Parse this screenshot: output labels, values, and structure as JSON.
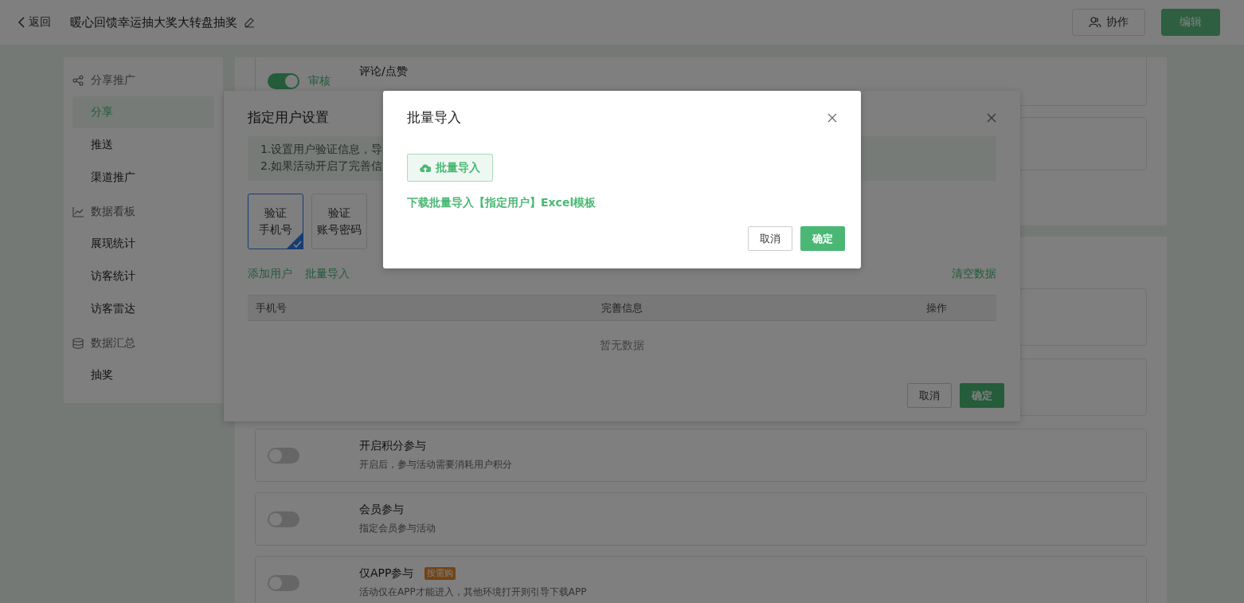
{
  "header": {
    "back": "返回",
    "title": "暖心回馈幸运抽大奖大转盘抽奖",
    "buttons": [
      {
        "label": "协作",
        "kind": "outline"
      },
      {
        "label": "编辑",
        "kind": "primary"
      }
    ]
  },
  "sidebar": {
    "groups": [
      {
        "label": "分享推广",
        "items": [
          {
            "label": "分享",
            "selected": true
          },
          {
            "label": "推送",
            "selected": false
          },
          {
            "label": "渠道推广",
            "selected": false
          }
        ]
      },
      {
        "label": "数据看板",
        "items": [
          {
            "label": "展现统计",
            "selected": false
          },
          {
            "label": "访客统计",
            "selected": false
          },
          {
            "label": "访客雷达",
            "selected": false
          }
        ]
      },
      {
        "label": "数据汇总",
        "items": [
          {
            "label": "抽奖",
            "selected": false
          }
        ]
      }
    ]
  },
  "main": {
    "sections": [
      {
        "cards": [
          {
            "kind": "setting",
            "on": true,
            "switch_label": "审核",
            "title": "评论/点赞"
          },
          {
            "kind": "blank"
          }
        ]
      },
      {
        "cards": [
          {
            "kind": "blank"
          },
          {
            "kind": "blank"
          },
          {
            "kind": "setting",
            "on": false,
            "title": "开启积分参与",
            "description": "开启后，参与活动需要消耗用户积分"
          },
          {
            "kind": "setting",
            "on": false,
            "title": "会员参与",
            "description": "指定会员参与活动"
          },
          {
            "kind": "setting",
            "on": false,
            "title": "仅APP参与",
            "badge": "按需购",
            "description": "活动仅在APP才能进入，其他环境打开则引导下载APP"
          }
        ]
      }
    ]
  },
  "user_dialog": {
    "title": "指定用户设置",
    "notes": [
      "1.设置用户验证信息，导",
      "2.如果活动开启了完善信"
    ],
    "tabs": [
      {
        "lines": [
          "验证",
          "手机号"
        ],
        "selected": true
      },
      {
        "lines": [
          "验证",
          "账号密码"
        ],
        "selected": false
      }
    ],
    "actions": [
      "添加用户",
      "批量导入"
    ],
    "clear": "清空数据",
    "columns": [
      "手机号",
      "完善信息",
      "操作"
    ],
    "empty": "暂无数据",
    "buttons": [
      {
        "label": "取消",
        "kind": "default"
      },
      {
        "label": "确定",
        "kind": "primary"
      }
    ]
  },
  "import_dialog": {
    "title": "批量导入",
    "upload": "批量导入",
    "link": "下载批量导入【指定用户】Excel模板",
    "buttons": [
      {
        "label": "取消",
        "kind": "default"
      },
      {
        "label": "确定",
        "kind": "primary"
      }
    ]
  }
}
